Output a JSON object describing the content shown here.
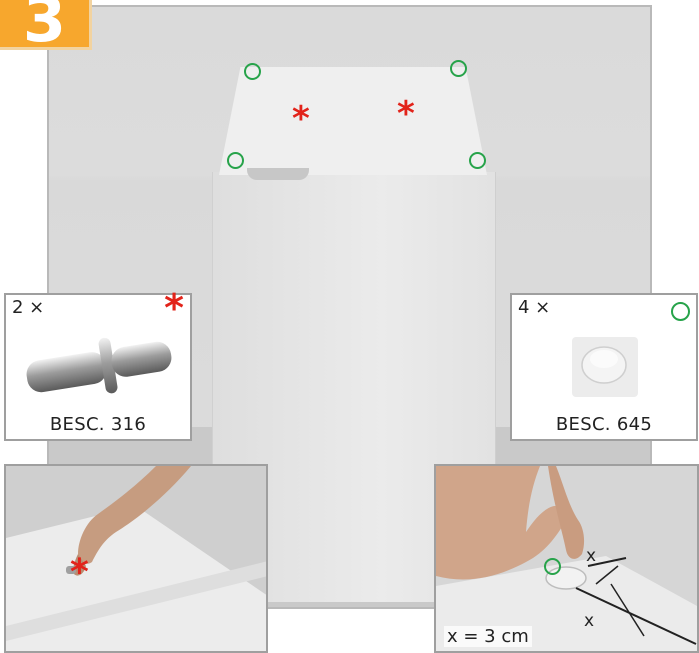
{
  "step": {
    "number": "3"
  },
  "colors": {
    "step_badge": "#f7a72d",
    "marker_circle": "#27a34a",
    "marker_star": "#e2231a"
  },
  "markers": {
    "circle_symbol": "○",
    "star_symbol": "*"
  },
  "parts": [
    {
      "quantity": "2 ×",
      "code": "BESC. 316",
      "marker": "star",
      "image": "shelf-pin"
    },
    {
      "quantity": "4 ×",
      "code": "BESC. 645",
      "marker": "circle",
      "image": "bumper-pad"
    }
  ],
  "details": {
    "left": {
      "image": "hand-inserting-shelf-pin"
    },
    "right": {
      "image": "hand-placing-bumper-pad",
      "measure_label": "x",
      "formula": "x = 3 cm"
    }
  }
}
